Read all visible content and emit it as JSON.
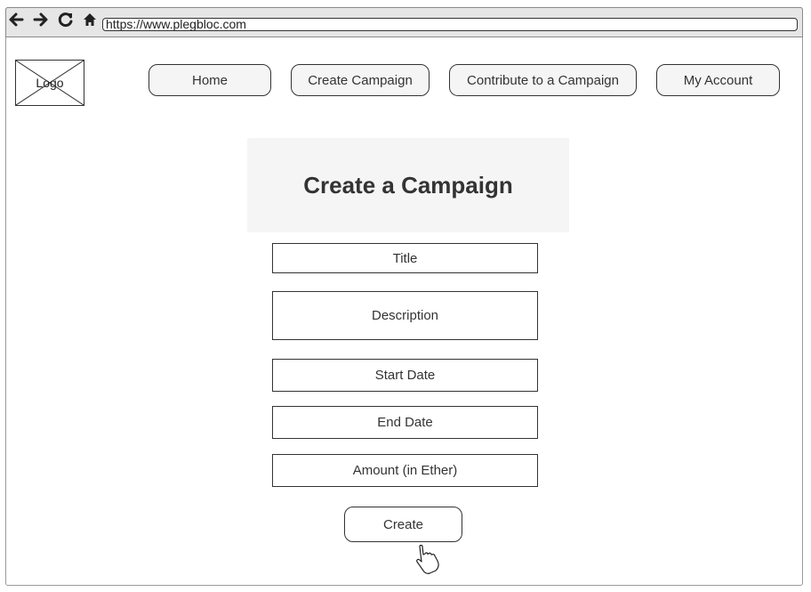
{
  "browser": {
    "url": "https://www.plegbloc.com",
    "icons": [
      "back-arrow-icon",
      "forward-arrow-icon",
      "reload-icon",
      "home-icon"
    ]
  },
  "header": {
    "logo_label": "Logo",
    "nav": {
      "home": "Home",
      "create_campaign": "Create Campaign",
      "contribute": "Contribute to a Campaign",
      "my_account": "My Account"
    }
  },
  "main": {
    "heading": "Create a Campaign",
    "fields": {
      "title": "Title",
      "description": "Description",
      "start_date": "Start Date",
      "end_date": "End Date",
      "amount": "Amount (in Ether)"
    },
    "create_label": "Create"
  },
  "colors": {
    "border": "#333333",
    "panel_bg": "#f5f5f5",
    "browser_bar_bg": "#e6e6e6"
  }
}
